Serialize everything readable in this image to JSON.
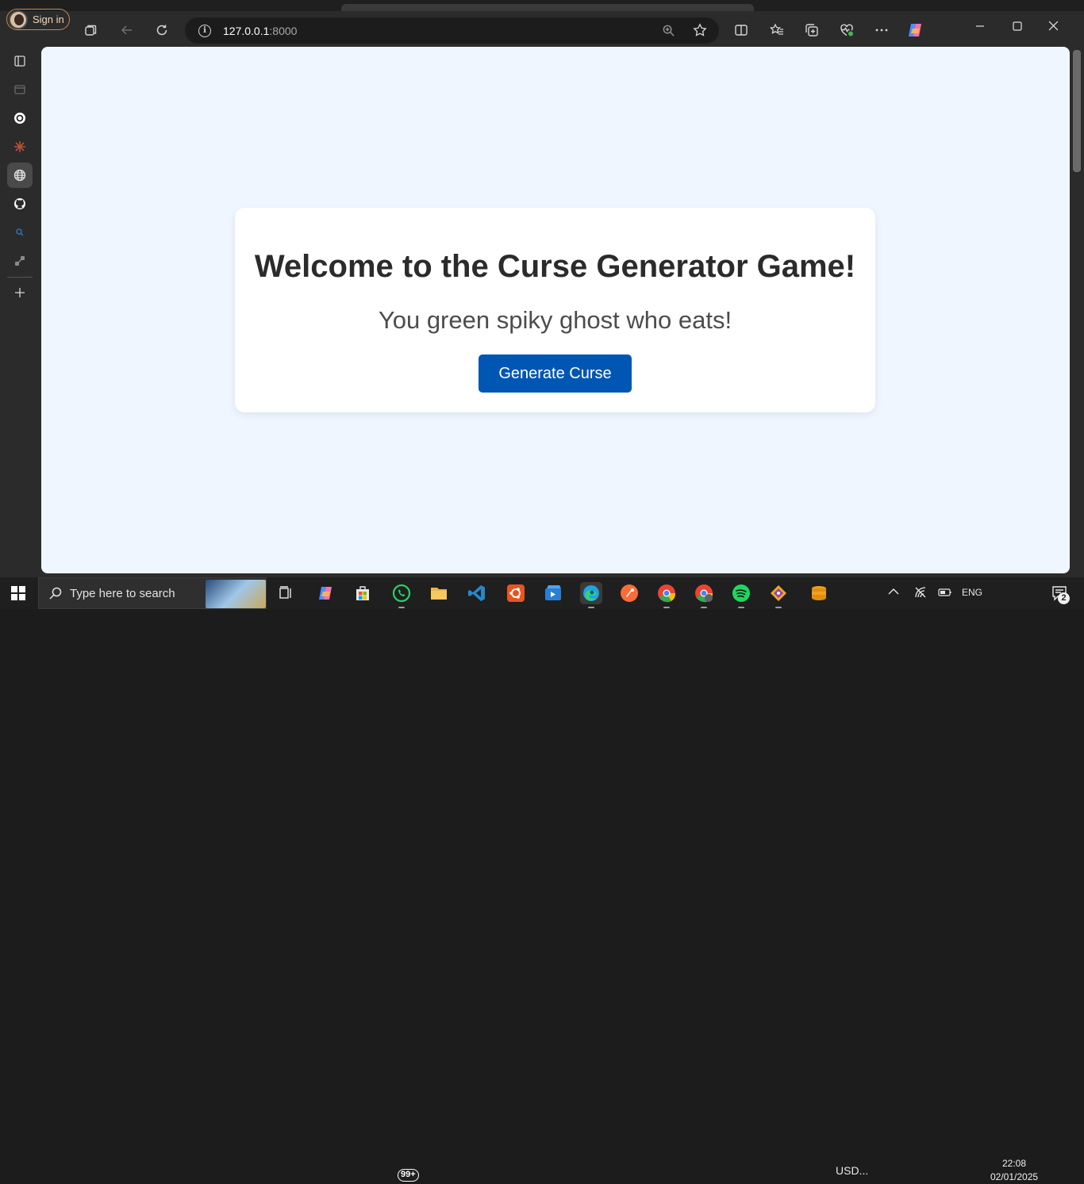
{
  "browser": {
    "signin_label": "Sign in",
    "url_host": "127.0.0.1",
    "url_port": ":8000"
  },
  "page": {
    "title": "Welcome to the Curse Generator Game!",
    "curse_text": "You green spiky ghost who eats!",
    "generate_button_label": "Generate Curse"
  },
  "taskbar": {
    "search_placeholder": "Type here to search",
    "whatsapp_badge": "99+",
    "usd_label": "USD...",
    "language": "ENG",
    "time": "22:08",
    "date": "02/01/2025",
    "notification_count": "2"
  },
  "colors": {
    "page_background": "#eff6ff",
    "button_primary": "#0056b3",
    "browser_chrome": "#2b2b2b"
  }
}
